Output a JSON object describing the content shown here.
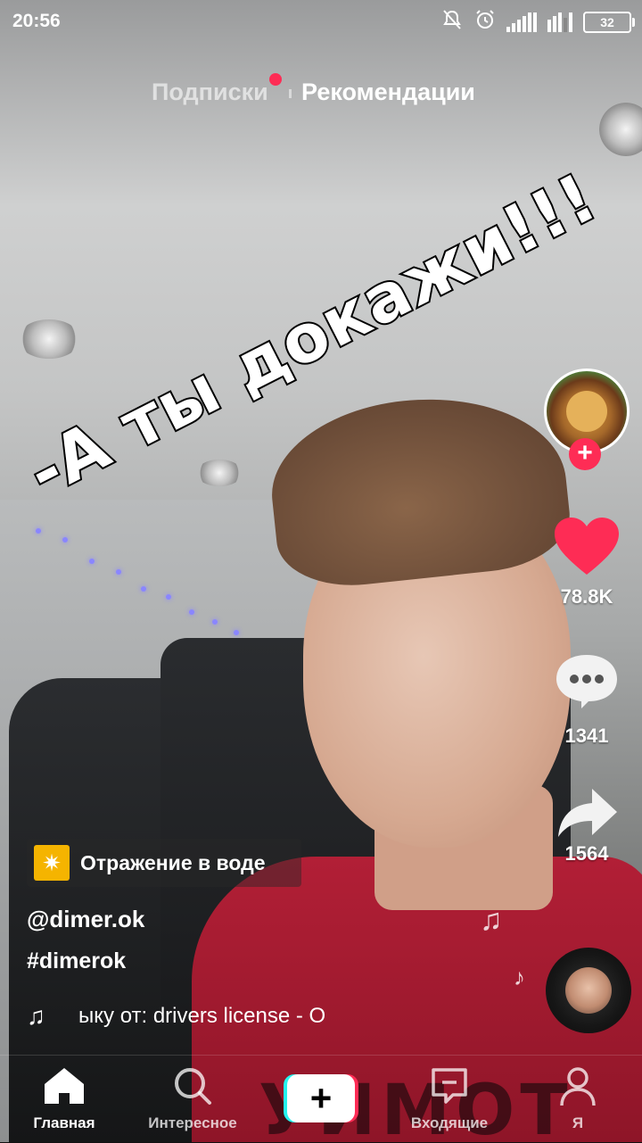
{
  "status_bar": {
    "time": "20:56",
    "battery": "32",
    "icons": [
      "muted-bell-icon",
      "alarm-icon",
      "signal-icon",
      "signal-icon",
      "battery-icon"
    ]
  },
  "top_tabs": {
    "following": "Подписки",
    "for_you": "Рекомендации",
    "active": "for_you"
  },
  "video": {
    "overlay_text": "-А ты докажи!!!"
  },
  "actions": {
    "likes": "78.8K",
    "comments": "1341",
    "shares": "1564",
    "like_color": "#fe2c55"
  },
  "info": {
    "effect_label": "Отражение в воде",
    "username": "@dimer.ok",
    "hashtag": "#dimerok",
    "music": "ыку от: drivers license - O"
  },
  "nav": {
    "home": "Главная",
    "discover": "Интересное",
    "inbox": "Входящие",
    "me": "Я"
  },
  "colors": {
    "accent": "#fe2c55",
    "cyan": "#25f4ee",
    "effect_icon": "#f5b400"
  }
}
